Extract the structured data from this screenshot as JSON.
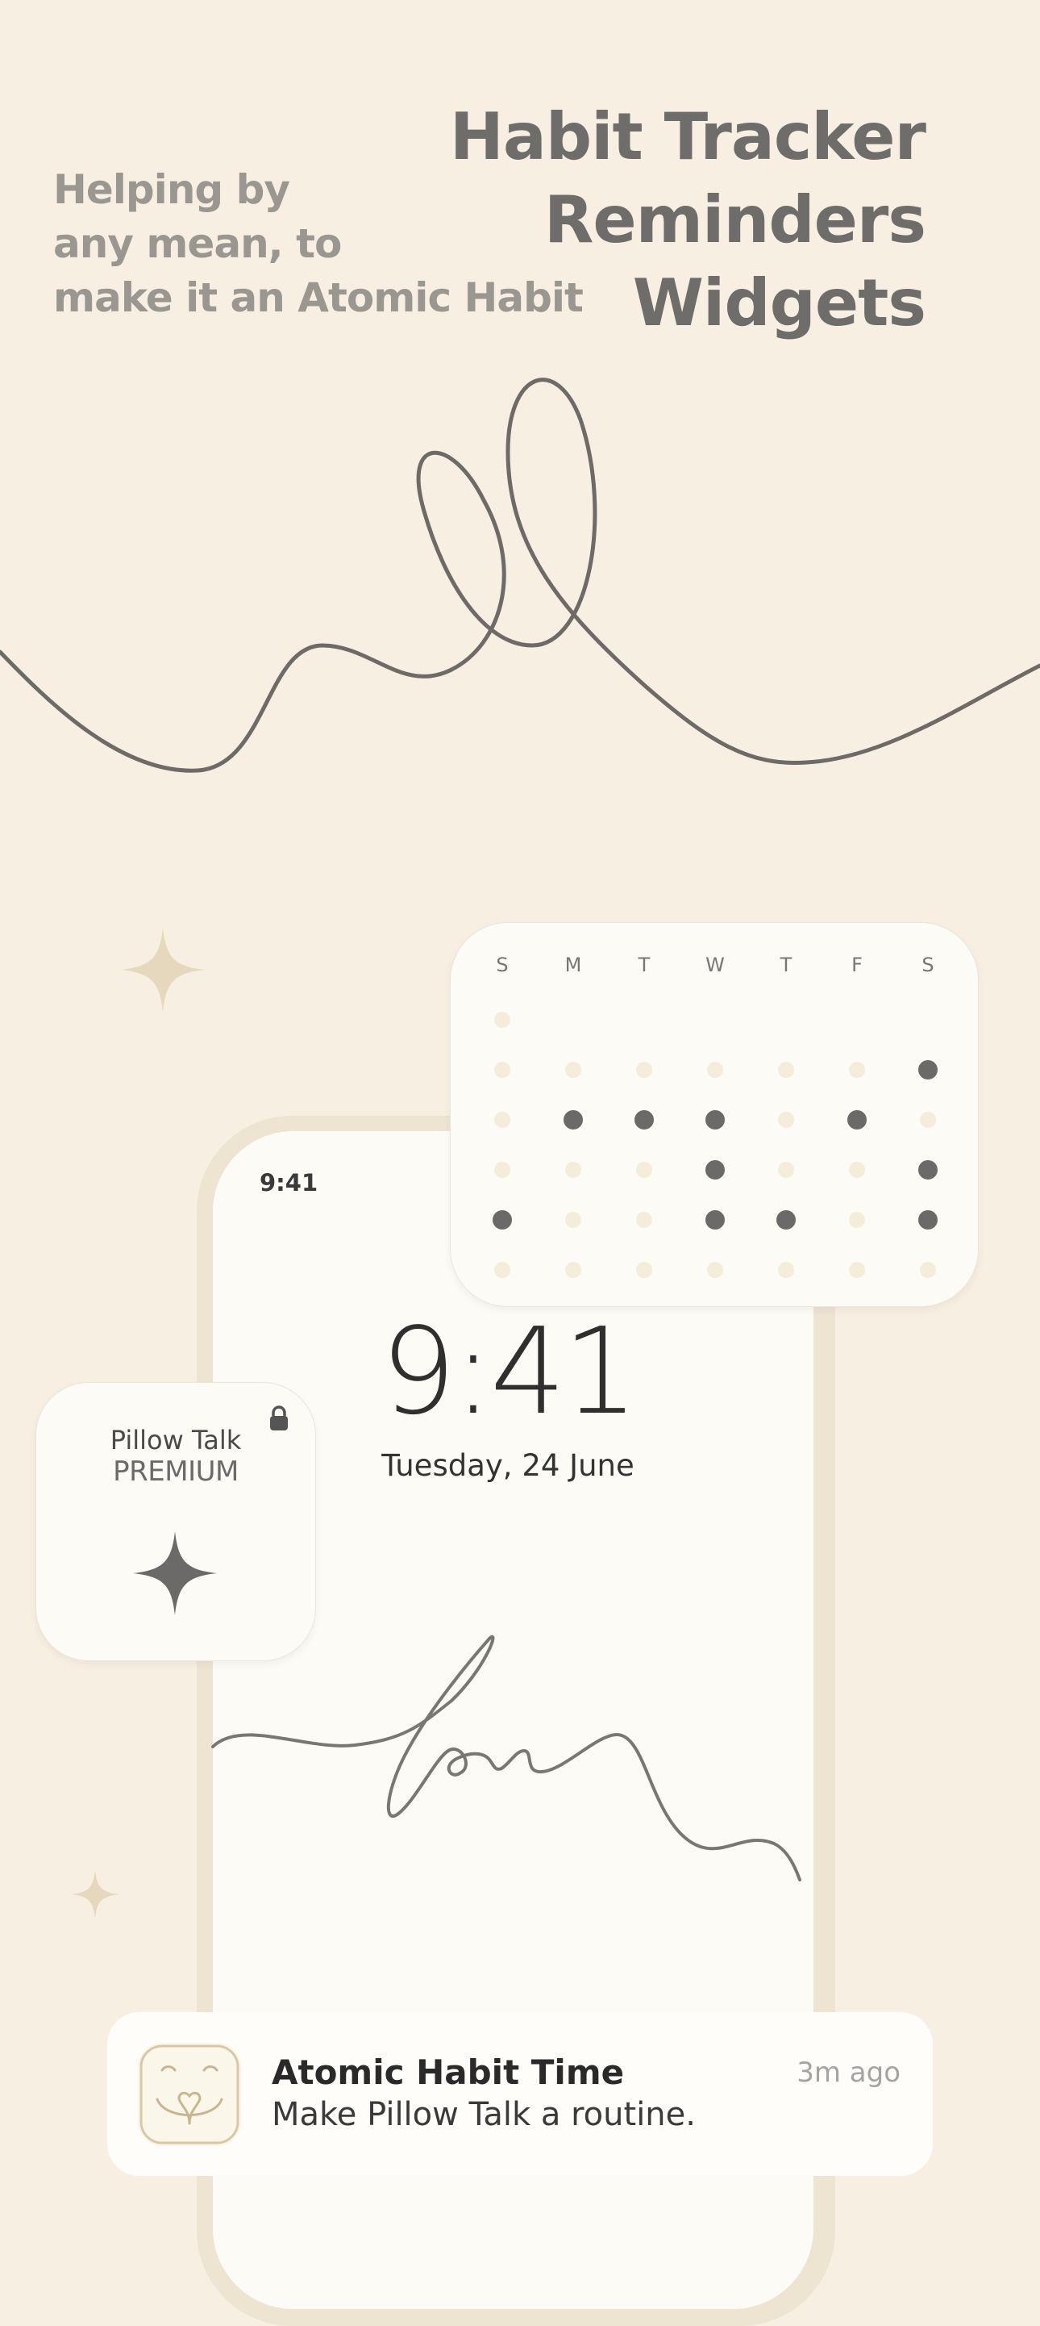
{
  "headline": {
    "lines": [
      "Habit Tracker",
      "Reminders",
      "Widgets"
    ]
  },
  "tagline": {
    "lines": [
      "Helping by",
      "any mean, to",
      "make it an Atomic Habit"
    ]
  },
  "phone": {
    "status_time": "9:41",
    "lock_time": "9:41",
    "lock_date_day": "Tuesday,",
    "lock_date_date": "24 June"
  },
  "calendar_widget": {
    "days": [
      "S",
      "M",
      "T",
      "W",
      "T",
      "F",
      "S"
    ],
    "rows": [
      [
        0,
        null,
        null,
        null,
        null,
        null,
        null
      ],
      [
        0,
        0,
        0,
        0,
        0,
        0,
        1
      ],
      [
        0,
        1,
        1,
        1,
        0,
        1,
        0
      ],
      [
        0,
        0,
        0,
        1,
        0,
        0,
        1
      ],
      [
        1,
        0,
        0,
        1,
        1,
        0,
        1
      ],
      [
        0,
        0,
        0,
        0,
        0,
        0,
        0
      ]
    ]
  },
  "premium_widget": {
    "title": "Pillow Talk",
    "subtitle": "PREMIUM",
    "lock_icon": "lock-icon",
    "star_icon": "sparkle-icon"
  },
  "notification": {
    "title": "Atomic Habit Time",
    "body": "Make Pillow Talk a routine.",
    "time": "3m ago",
    "app_icon": "pillow-talk-app-icon"
  },
  "colors": {
    "background": "#f7f0e2",
    "text_dark": "#6f6d6a",
    "text_muted": "#9a9791",
    "dot_filled": "#6b6a69",
    "dot_empty": "#f3edda",
    "sparkle": "#e6d8bc"
  }
}
